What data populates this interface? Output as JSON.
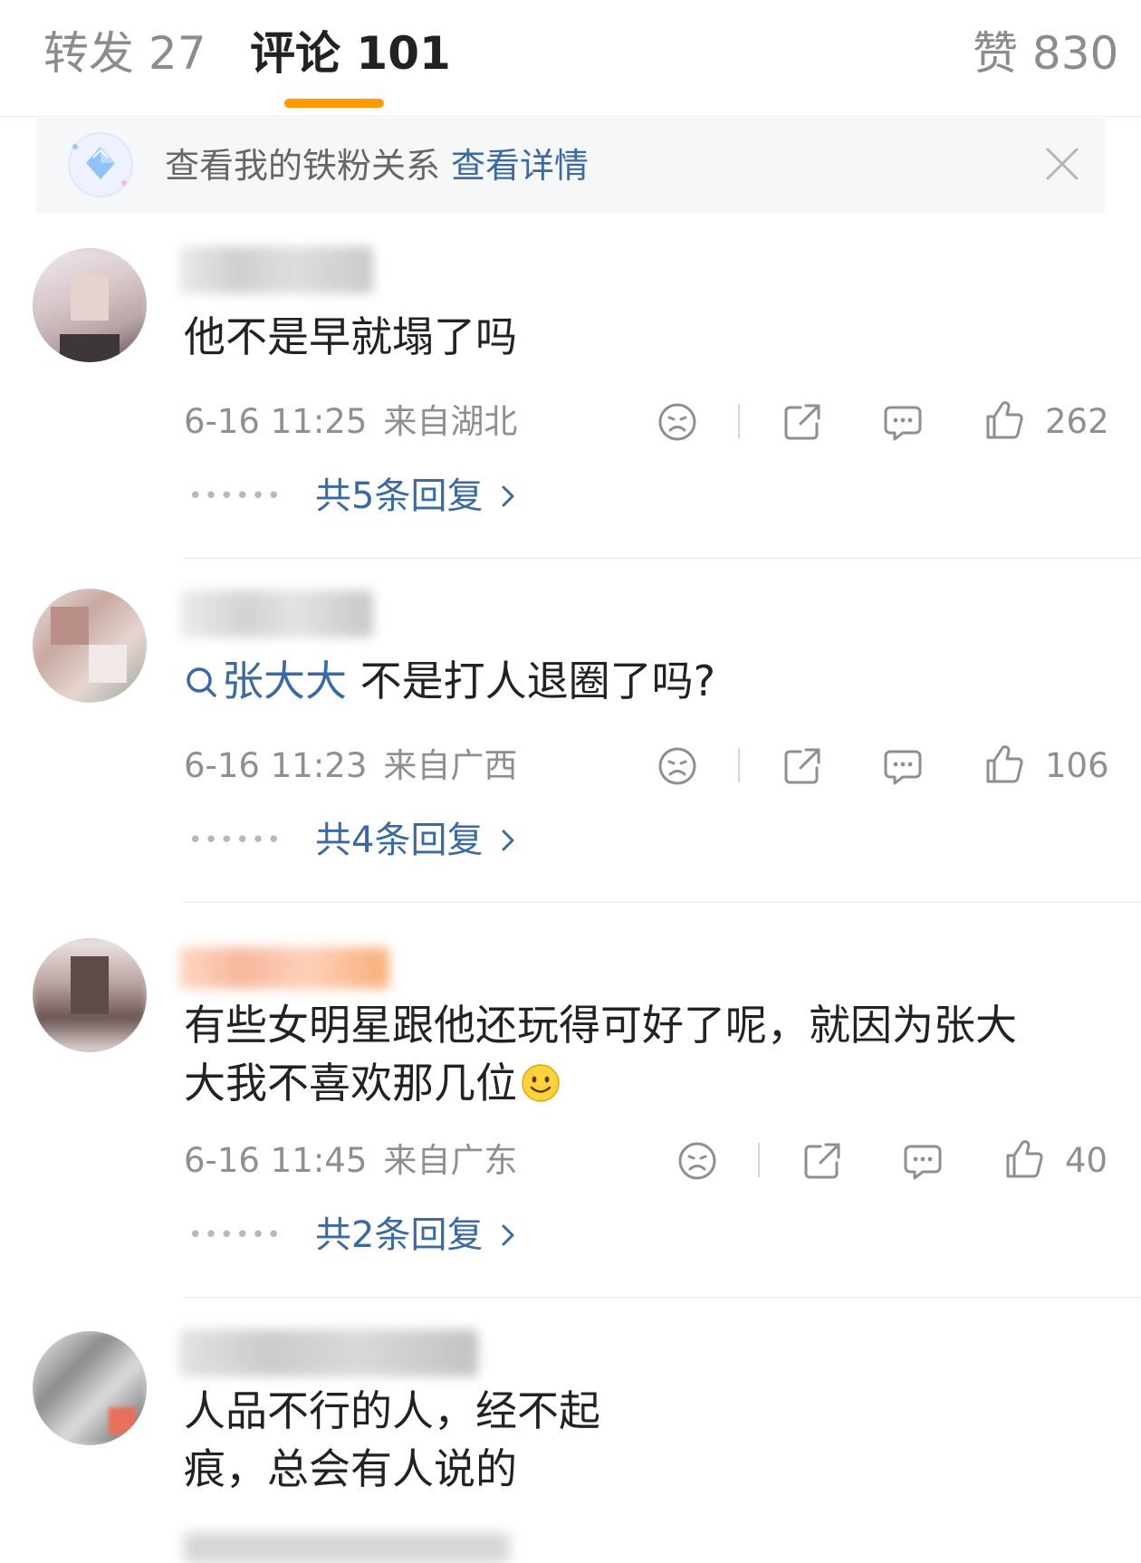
{
  "tabs": {
    "repost": "转发 27",
    "comments": "评论 101",
    "likes": "赞 830"
  },
  "fan_banner": {
    "text": "查看我的铁粉关系",
    "link": "查看详情"
  },
  "comments": [
    {
      "text": "他不是早就塌了吗",
      "time": "6-16 11:25",
      "location": "来自湖北",
      "likes": "262",
      "replies": "共5条回复"
    },
    {
      "mention": "张大大",
      "text": " 不是打人退圈了吗?",
      "time": "6-16 11:23",
      "location": "来自广西",
      "likes": "106",
      "replies": "共4条回复"
    },
    {
      "text_line1": "有些女明星跟他还玩得可好了呢，就因为张大",
      "text_line2": "大我不喜欢那几位",
      "time": "6-16 11:45",
      "location": "来自广东",
      "likes": "40",
      "replies": "共2条回复"
    },
    {
      "text_line1": "人品不行的人，经不起",
      "text_line2": "痕，总会有人说的"
    }
  ],
  "colors": {
    "accent_orange": "#ff9a00",
    "link_blue": "#3b6aa3",
    "meta_gray": "#8f8f8f"
  },
  "icons": [
    "diamond-fan-icon",
    "close-icon",
    "dislike-face-icon",
    "share-icon",
    "comment-bubble-icon",
    "thumbs-up-icon",
    "chevron-right-icon",
    "search-mention-icon",
    "smiley-emoji-icon"
  ]
}
